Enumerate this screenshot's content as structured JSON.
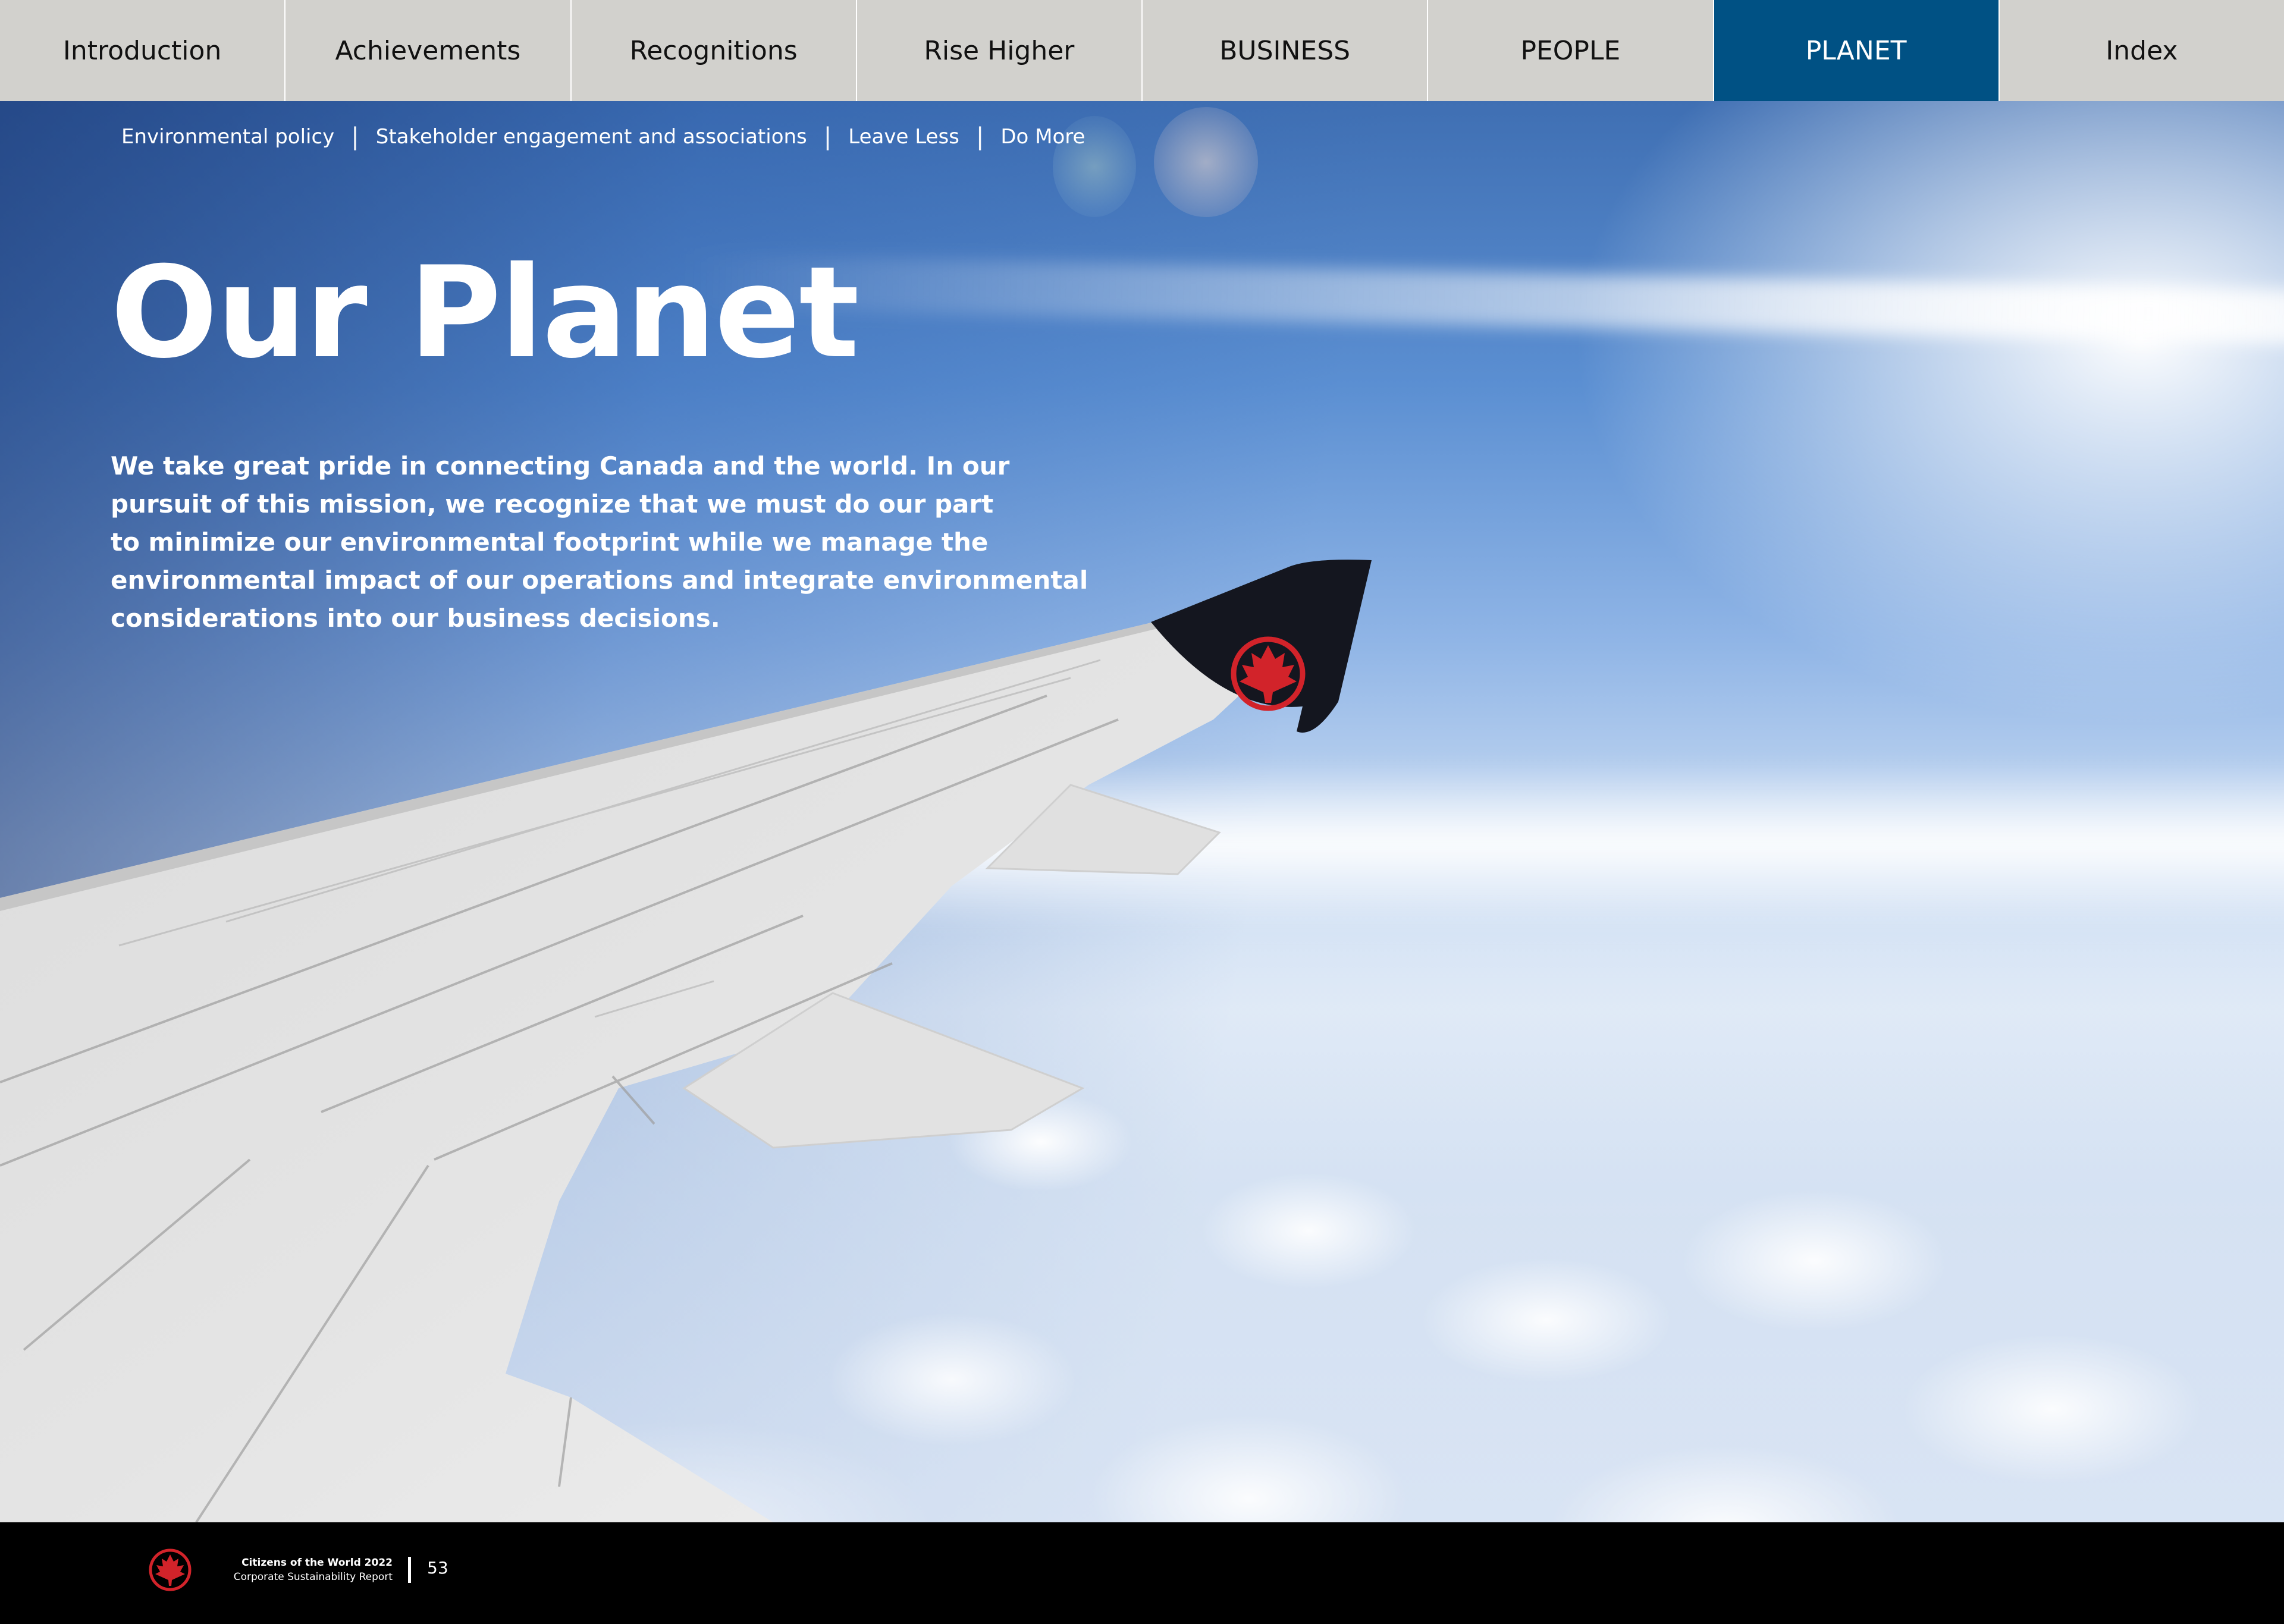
{
  "topnav": {
    "tabs": [
      {
        "label": "Introduction"
      },
      {
        "label": "Achievements"
      },
      {
        "label": "Recognitions"
      },
      {
        "label": "Rise Higher"
      },
      {
        "label": "BUSINESS"
      },
      {
        "label": "PEOPLE"
      },
      {
        "label": "PLANET",
        "active": true
      },
      {
        "label": "Index"
      }
    ],
    "active_color": "#005184"
  },
  "subnav": {
    "links": [
      {
        "label": "Environmental policy"
      },
      {
        "label": "Stakeholder engagement and associations"
      },
      {
        "label": "Leave Less"
      },
      {
        "label": "Do More"
      }
    ],
    "separator": "|"
  },
  "hero": {
    "title": "Our Planet",
    "intro_lines": [
      "We take great pride in connecting Canada and the world. In our",
      "pursuit of this mission, we recognize that we must do our part",
      "to minimize our environmental footprint while we manage the",
      "environmental impact of our operations and integrate environmental",
      "considerations into our business decisions."
    ]
  },
  "footer": {
    "report_title": "Citizens of the World 2022",
    "report_subtitle": "Corporate Sustainability Report",
    "page_number": "53",
    "logo_icon": "maple-leaf-roundel-icon",
    "logo_color": "#d2232a"
  }
}
